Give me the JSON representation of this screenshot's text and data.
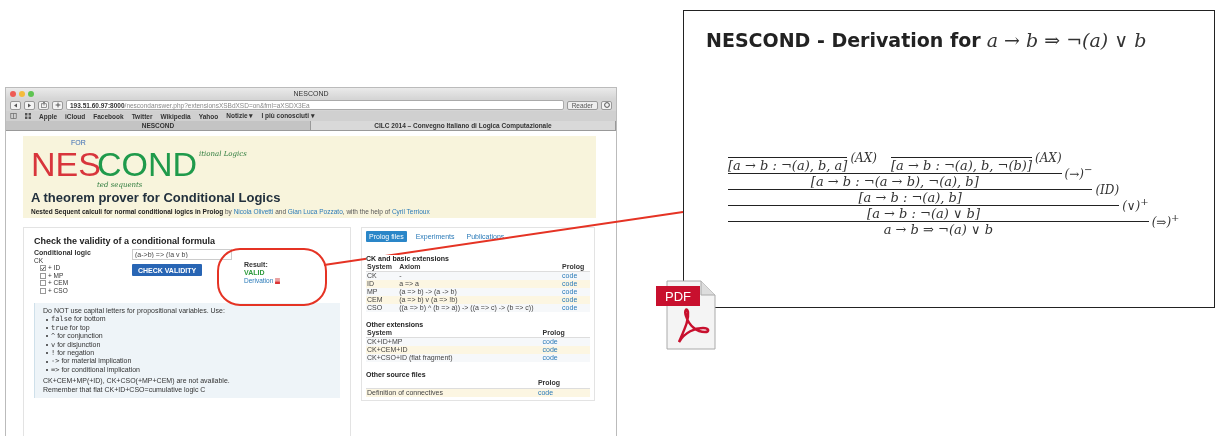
{
  "browser": {
    "title": "NESCOND",
    "url_host": "193.51.60.97:8000",
    "url_path": "/nescondanswer.php?extensionsXSBdXSD=on&fml=aXSDX3Ea",
    "reader_button": "Reader",
    "bookmarks": [
      {
        "label": "Apple"
      },
      {
        "label": "iCloud"
      },
      {
        "label": "Facebook"
      },
      {
        "label": "Twitter"
      },
      {
        "label": "Wikipedia"
      },
      {
        "label": "Yahoo"
      },
      {
        "label": "Notizie ▾"
      },
      {
        "label": "I più conosciuti ▾"
      }
    ],
    "tabs": [
      {
        "label": "NESCOND",
        "selected": true
      },
      {
        "label": "CILC 2014 – Convegno Italiano di Logica Computazionale",
        "selected": false
      }
    ]
  },
  "banner": {
    "logo": {
      "for": "FOR",
      "parts": [
        {
          "text": "NES",
          "color": "#d8353c"
        },
        {
          "text": "COND",
          "color": "#1f9a4b"
        }
      ],
      "suffix_top": "itional Logics",
      "suffix_bottom": "ted sequents"
    },
    "title": "A theorem prover for Conditional Logics",
    "subtitle": "Nested Sequent calculi for normal conditional logics in Prolog",
    "byline": [
      {
        "kind": "text",
        "text": "by "
      },
      {
        "kind": "link",
        "text": "Nicola Olivetti"
      },
      {
        "kind": "text",
        "text": " and "
      },
      {
        "kind": "link",
        "text": "Gian Luca Pozzato"
      },
      {
        "kind": "text",
        "text": ", with the help of "
      },
      {
        "kind": "link",
        "text": "Cyril Terrioux"
      }
    ]
  },
  "checker": {
    "heading": "Check the validity of a conditional formula",
    "logic_label": "Conditional logic",
    "base": "CK",
    "options": [
      {
        "label": "+ ID",
        "checked": true
      },
      {
        "label": "+ MP",
        "checked": false
      },
      {
        "label": "+ CEM",
        "checked": false
      },
      {
        "label": "+ CSO",
        "checked": false
      }
    ],
    "formula": "(a->b) => (!a v b)",
    "button": "CHECK VALIDITY",
    "result_label": "Result:",
    "result": "VALID",
    "derivation_link": "Derivation"
  },
  "notes": {
    "intro": "Do NOT use capital letters for propositional variables. Use:",
    "items": [
      {
        "code": "false",
        "text": " for bottom"
      },
      {
        "code": "true",
        "text": " for top"
      },
      {
        "code": "^",
        "text": " for conjunction"
      },
      {
        "code": "v",
        "text": " for disjunction"
      },
      {
        "code": "!",
        "text": " for negation"
      },
      {
        "code": "->",
        "text": " for material implication"
      },
      {
        "code": "=>",
        "text": " for conditional implication"
      }
    ],
    "footer": [
      "CK+CEM+MP(+ID), CK+CSO(+MP+CEM) are not available.",
      "Remember that flat CK+ID+CSO=cumulative logic C"
    ]
  },
  "files": {
    "tabs": [
      {
        "label": "Prolog files",
        "selected": true
      },
      {
        "label": "Experiments",
        "selected": false
      },
      {
        "label": "Publications",
        "selected": false
      }
    ],
    "sections": [
      {
        "title": "CK and basic extensions",
        "columns": [
          "System",
          "Axiom",
          "Prolog"
        ],
        "rows": [
          [
            "CK",
            "-",
            "code"
          ],
          [
            "ID",
            "a => a",
            "code"
          ],
          [
            "MP",
            "(a => b) -> (a -> b)",
            "code"
          ],
          [
            "CEM",
            "(a => b) v (a => !b)",
            "code"
          ],
          [
            "CSO",
            "((a => b) ^ (b => a)) -> ((a => c) -> (b => c))",
            "code"
          ]
        ]
      },
      {
        "title": "Other extensions",
        "columns": [
          "System",
          "Prolog"
        ],
        "rows": [
          [
            "CK+ID+MP",
            "code"
          ],
          [
            "CK+CEM+ID",
            "code"
          ],
          [
            "CK+CSO+ID (flat fragment)",
            "code"
          ]
        ]
      },
      {
        "title": "Other source files",
        "columns": [
          "",
          "Prolog"
        ],
        "rows": [
          [
            "Definition of connectives",
            "code"
          ]
        ]
      }
    ]
  },
  "derivation": {
    "title": "NESCOND - Derivation for",
    "formula": "a → b ⇒ ¬(a) ∨ b",
    "tree": {
      "conclusion": "a → b ⇒ ¬(a) ∨ b",
      "rule": "(⇒)$^{+}$",
      "premises": [
        {
          "conclusion": "[a → b : ¬(a) ∨ b]",
          "rule": "(∨)$^{+}$",
          "premises": [
            {
              "conclusion": "[a → b : ¬(a), b]",
              "rule": "(ID)",
              "premises": [
                {
                  "conclusion": "[a → b : ¬(a → b), ¬(a), b]",
                  "rule": "(→)$^{−}$",
                  "premises": [
                    {
                      "conclusion": "[a → b : ¬(a), b, a]",
                      "rule": "(AX)"
                    },
                    {
                      "conclusion": "[a → b : ¬(a), b, ¬(b)]",
                      "rule": "(AX)"
                    }
                  ]
                }
              ]
            }
          ]
        }
      ]
    }
  },
  "pdf_icon": {
    "label": "PDF"
  }
}
